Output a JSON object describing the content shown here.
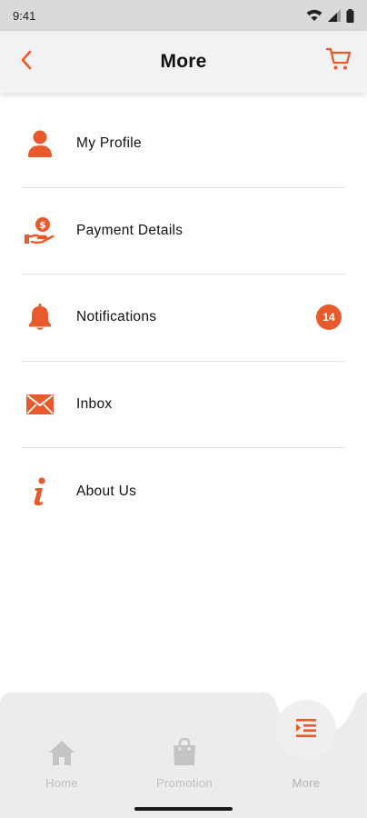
{
  "status_bar": {
    "time": "9:41",
    "icons": [
      "wifi-icon",
      "signal-icon",
      "battery-icon"
    ]
  },
  "header": {
    "title": "More",
    "back_icon": "chevron-left-icon",
    "cart_icon": "cart-icon"
  },
  "menu": {
    "items": [
      {
        "label": "My Profile",
        "icon": "user-icon"
      },
      {
        "label": "Payment Details",
        "icon": "payment-icon"
      },
      {
        "label": "Notifications",
        "icon": "bell-icon",
        "badge": "14"
      },
      {
        "label": "Inbox",
        "icon": "envelope-icon"
      },
      {
        "label": "About Us",
        "icon": "info-icon"
      }
    ]
  },
  "bottom_nav": {
    "items": [
      {
        "label": "Home",
        "icon": "home-icon"
      },
      {
        "label": "Promotion",
        "icon": "shopping-bag-icon"
      },
      {
        "label": "More",
        "icon": "menu-indent-icon",
        "active": true
      }
    ]
  },
  "colors": {
    "accent": "#e8592b",
    "header_bg": "#f2f2f2",
    "status_bar_bg": "#d9d9d9",
    "nav_bg": "#ececec",
    "nav_inactive": "#bdbdbd"
  }
}
